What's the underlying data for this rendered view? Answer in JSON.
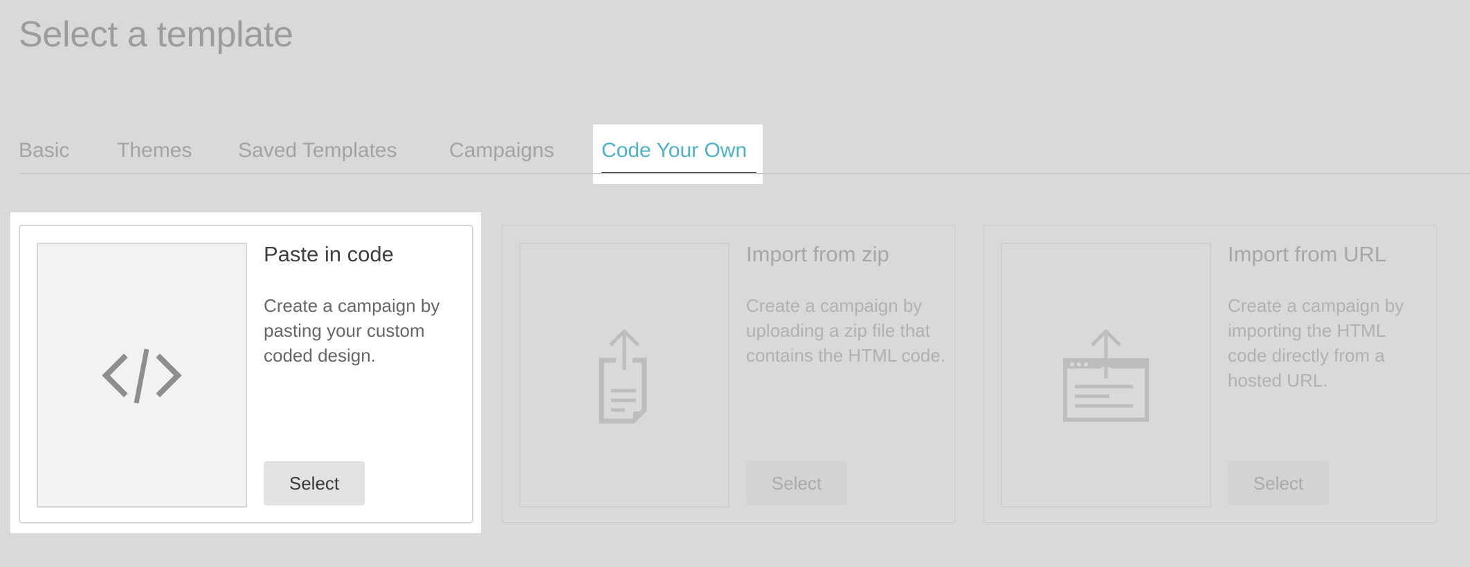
{
  "page": {
    "title": "Select a template"
  },
  "tabs": [
    {
      "label": "Basic"
    },
    {
      "label": "Themes"
    },
    {
      "label": "Saved Templates"
    },
    {
      "label": "Campaigns"
    },
    {
      "label": "Code Your Own",
      "active": true
    }
  ],
  "colors": {
    "active_tab": "#4ab3c9",
    "background_overlay": "#d9d9d9"
  },
  "cards": [
    {
      "title": "Paste in code",
      "description": "Create a campaign by pasting your custom coded design.",
      "button_label": "Select",
      "icon": "code-icon",
      "highlighted": true
    },
    {
      "title": "Import from zip",
      "description": "Create a campaign by uploading a zip file that contains the HTML code.",
      "button_label": "Select",
      "icon": "upload-file-icon",
      "highlighted": false
    },
    {
      "title": "Import from URL",
      "description": "Create a campaign by importing the HTML code directly from a hosted URL.",
      "button_label": "Select",
      "icon": "upload-browser-icon",
      "highlighted": false
    }
  ]
}
